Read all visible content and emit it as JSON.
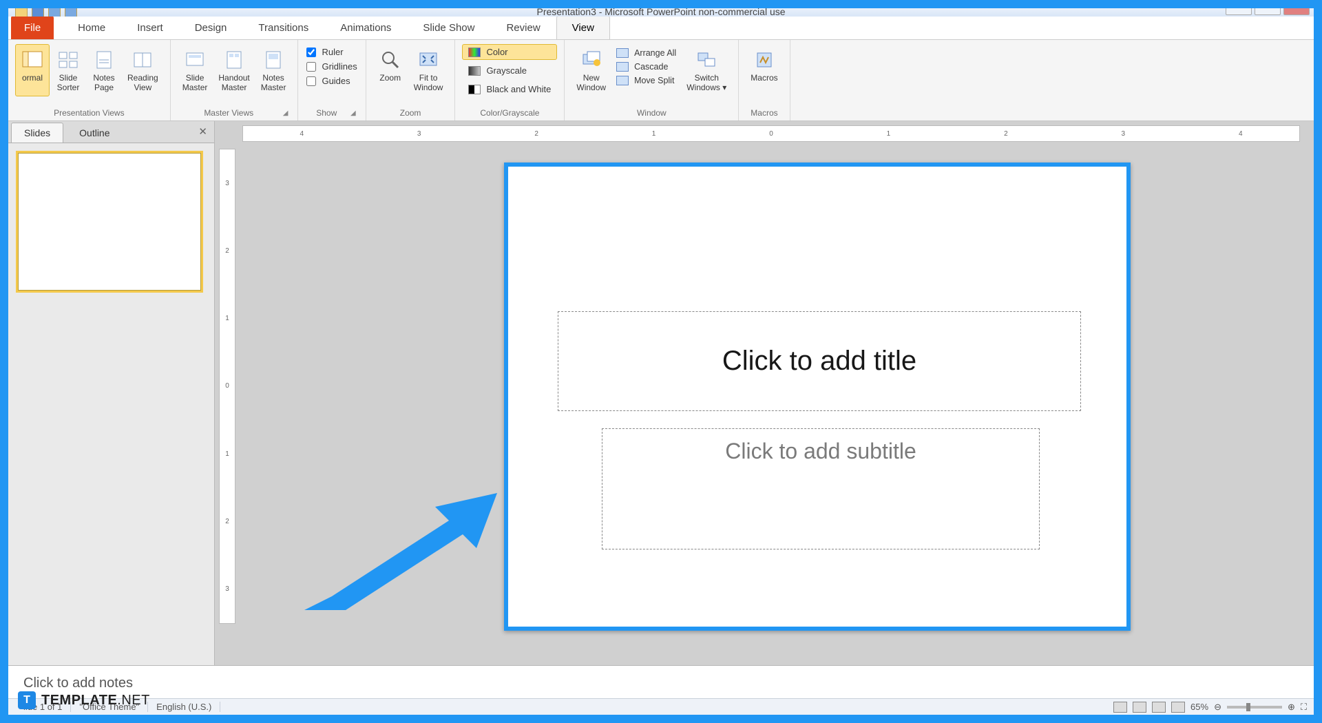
{
  "title": "Presentation3 - Microsoft PowerPoint non-commercial use",
  "tabs": {
    "file": "File",
    "home": "Home",
    "insert": "Insert",
    "design": "Design",
    "transitions": "Transitions",
    "animations": "Animations",
    "slideshow": "Slide Show",
    "review": "Review",
    "view": "View"
  },
  "ribbon": {
    "presentation_views": {
      "label": "Presentation Views",
      "normal": "ormal",
      "sorter": "Slide\nSorter",
      "notes": "Notes\nPage",
      "reading": "Reading\nView"
    },
    "master_views": {
      "label": "Master Views",
      "slide": "Slide\nMaster",
      "handout": "Handout\nMaster",
      "notes": "Notes\nMaster"
    },
    "show": {
      "label": "Show",
      "ruler": "Ruler",
      "gridlines": "Gridlines",
      "guides": "Guides"
    },
    "zoom": {
      "label": "Zoom",
      "zoom": "Zoom",
      "fit": "Fit to\nWindow"
    },
    "color": {
      "label": "Color/Grayscale",
      "color": "Color",
      "gray": "Grayscale",
      "bw": "Black and White"
    },
    "window": {
      "label": "Window",
      "new": "New\nWindow",
      "arrange": "Arrange All",
      "cascade": "Cascade",
      "split": "Move Split",
      "switch": "Switch\nWindows"
    },
    "macros": {
      "label": "Macros",
      "macros": "Macros"
    }
  },
  "left_pane": {
    "slides": "Slides",
    "outline": "Outline"
  },
  "slide": {
    "title_ph": "Click to add title",
    "subtitle_ph": "Click to add subtitle"
  },
  "notes_ph": "Click to add notes",
  "ruler_h": [
    "4",
    "3",
    "2",
    "1",
    "0",
    "1",
    "2",
    "3",
    "4"
  ],
  "ruler_v": [
    "3",
    "2",
    "1",
    "0",
    "1",
    "2",
    "3"
  ],
  "status": {
    "slide": "lide 1 of 1",
    "theme": "\"Office Theme\"",
    "lang": "English (U.S.)",
    "zoom": "65%"
  },
  "watermark": "TEMPLATE.NET"
}
